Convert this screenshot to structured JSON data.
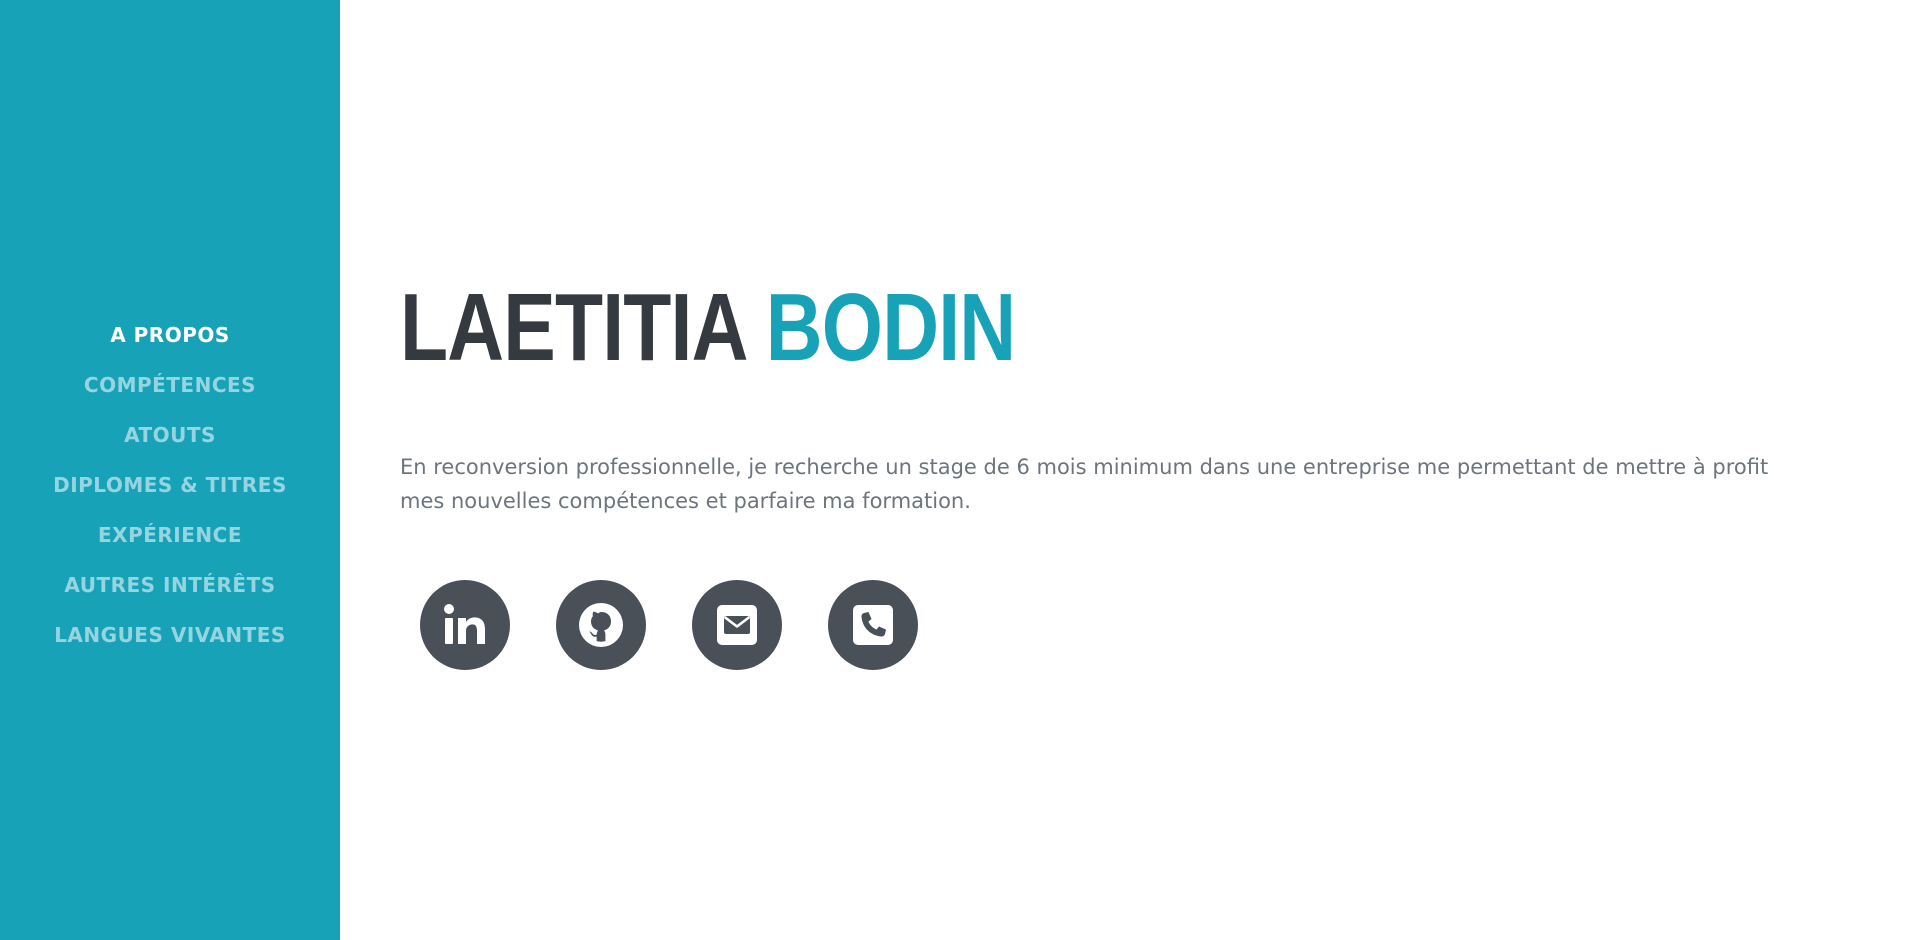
{
  "nav": {
    "items": [
      {
        "label": "A PROPOS",
        "active": true
      },
      {
        "label": "COMPÉTENCES",
        "active": false
      },
      {
        "label": "ATOUTS",
        "active": false
      },
      {
        "label": "DIPLOMES & TITRES",
        "active": false
      },
      {
        "label": "EXPÉRIENCE",
        "active": false
      },
      {
        "label": "AUTRES INTÉRÊTS",
        "active": false
      },
      {
        "label": "LANGUES VIVANTES",
        "active": false
      }
    ]
  },
  "about": {
    "first_name": "LAETITIA",
    "last_name": "BODIN",
    "lead": "En reconversion professionnelle, je recherche un stage de 6 mois minimum dans une entreprise me permettant de mettre à profit mes nouvelles compétences et parfaire ma formation."
  },
  "social": [
    {
      "icon": "linkedin-icon"
    },
    {
      "icon": "github-icon"
    },
    {
      "icon": "envelope-square-icon"
    },
    {
      "icon": "phone-square-icon"
    }
  ],
  "colors": {
    "primary": "#17a2b8",
    "dark": "#343a40",
    "muted": "#6c757d",
    "icon_bg": "#495057"
  }
}
